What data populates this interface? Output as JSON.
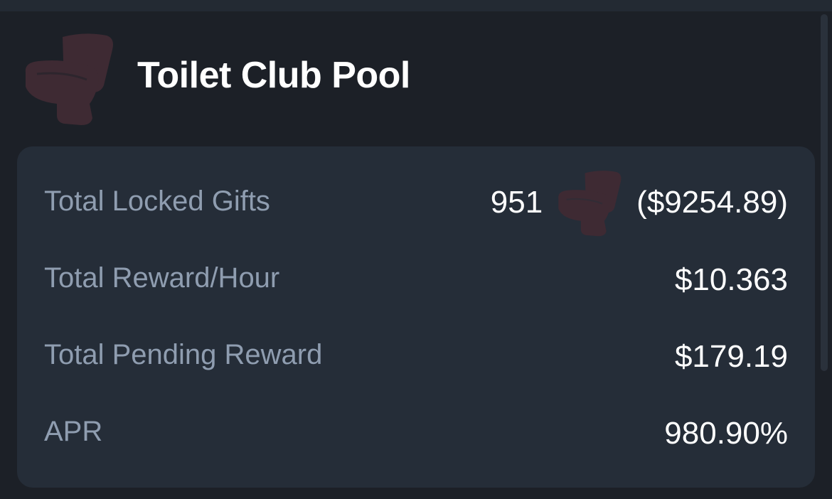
{
  "pool": {
    "title": "Toilet Club Pool",
    "icon": "toilet-icon",
    "icon_color": "#3e2a33"
  },
  "stats": [
    {
      "label": "Total Locked Gifts",
      "count": "951",
      "usd": "($9254.89)",
      "icon": "toilet-icon"
    },
    {
      "label": "Total Reward/Hour",
      "value": "$10.363"
    },
    {
      "label": "Total Pending Reward",
      "value": "$179.19"
    },
    {
      "label": "APR",
      "value": "980.90%"
    }
  ],
  "colors": {
    "background": "#1c2027",
    "card": "#252d38",
    "label": "#8f9db0",
    "value": "#ffffff"
  }
}
